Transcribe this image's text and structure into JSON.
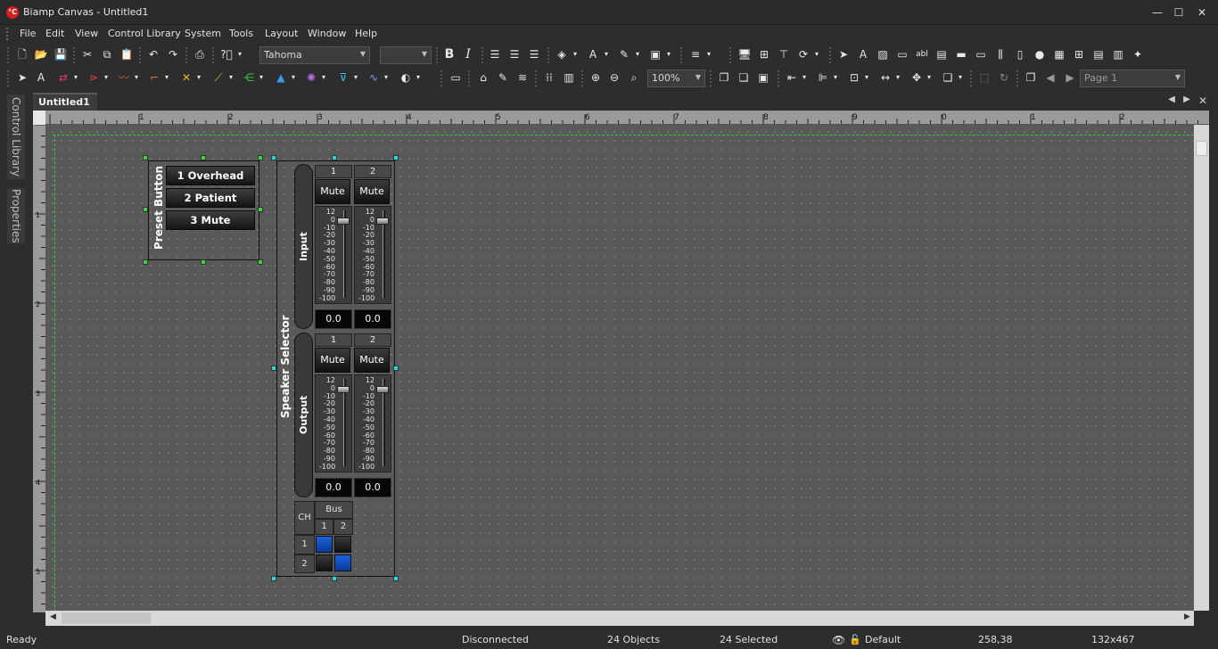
{
  "window": {
    "title": "Biamp Canvas - Untitled1",
    "app_icon": "biamp-canvas-icon",
    "min_label": "—",
    "max_label": "☐",
    "close_label": "✕"
  },
  "menu": {
    "items": [
      "File",
      "Edit",
      "View",
      "Control Library",
      "System",
      "Tools",
      "Layout",
      "Window",
      "Help"
    ]
  },
  "toolbar": {
    "font_name": "Tahoma",
    "font_size": "",
    "zoom": "100%",
    "page": "Page 1"
  },
  "sidebar": {
    "tabs": [
      "Control Library",
      "Properties"
    ]
  },
  "document": {
    "tab": "Untitled1"
  },
  "ruler": {
    "h_labels": [
      "1",
      "2",
      "3",
      "4",
      "5",
      "6",
      "7",
      "8",
      "9",
      "0",
      "1",
      "2"
    ],
    "v_labels": [
      "1",
      "2",
      "3",
      "4",
      "5"
    ]
  },
  "preset_button": {
    "label": "Preset Button",
    "buttons": [
      "1 Overhead",
      "2 Patient",
      "3 Mute"
    ]
  },
  "speaker_selector": {
    "label": "Speaker Selector",
    "input": {
      "label": "Input",
      "channels": [
        {
          "num": "1",
          "mute": "Mute",
          "value": "0.0"
        },
        {
          "num": "2",
          "mute": "Mute",
          "value": "0.0"
        }
      ]
    },
    "output": {
      "label": "Output",
      "channels": [
        {
          "num": "1",
          "mute": "Mute",
          "value": "0.0"
        },
        {
          "num": "2",
          "mute": "Mute",
          "value": "0.0"
        }
      ]
    },
    "scale": [
      "12",
      "0",
      "-10",
      "-20",
      "-30",
      "-40",
      "-50",
      "-60",
      "-70",
      "-80",
      "-90",
      "-100"
    ],
    "matrix": {
      "ch_label": "CH",
      "bus_label": "Bus",
      "bus_cols": [
        "1",
        "2"
      ],
      "ch_rows": [
        "1",
        "2"
      ],
      "state": [
        [
          true,
          false
        ],
        [
          false,
          true
        ]
      ]
    }
  },
  "status": {
    "ready": "Ready",
    "connection": "Disconnected",
    "objects": "24 Objects",
    "selected": "24 Selected",
    "layer": "Default",
    "position": "258,38",
    "size": "132x467"
  },
  "colors": {
    "accent_selected": "#1d63d8",
    "handle_green": "#39d43a",
    "handle_cyan": "#27d7e8",
    "guide": "#33cc33"
  }
}
